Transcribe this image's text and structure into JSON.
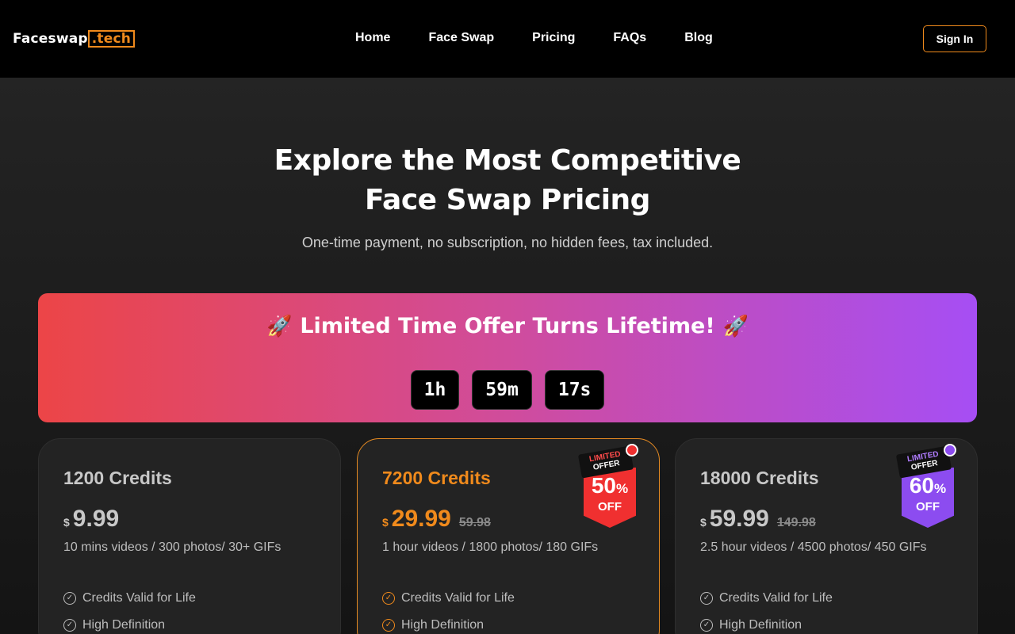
{
  "header": {
    "logo_main": "Faceswap",
    "logo_tld": ".tech",
    "nav": [
      "Home",
      "Face Swap",
      "Pricing",
      "FAQs",
      "Blog"
    ],
    "signin": "Sign In"
  },
  "hero": {
    "title": "Explore the Most Competitive Face Swap Pricing",
    "subtitle": "One-time payment, no subscription, no hidden fees, tax included."
  },
  "banner": {
    "title": "Limited Time Offer Turns Lifetime!",
    "icon": "rocket-icon",
    "timer": {
      "hours": "1h",
      "minutes": "59m",
      "seconds": "17s"
    }
  },
  "plans": [
    {
      "name": "1200 Credits",
      "currency": "$",
      "price": "9.99",
      "old_price": "",
      "desc": "10 mins videos / 300 photos/ 30+ GIFs",
      "features": [
        "Credits Valid for Life",
        "High Definition"
      ]
    },
    {
      "name": "7200 Credits",
      "currency": "$",
      "price": "29.99",
      "old_price": "59.98",
      "desc": "1 hour videos / 1800 photos/ 180 GIFs",
      "features": [
        "Credits Valid for Life",
        "High Definition"
      ],
      "badge": {
        "line1": "LIMITED",
        "line2": "OFFER",
        "pct": "50",
        "pct_sign": "%",
        "off": "OFF"
      }
    },
    {
      "name": "18000 Credits",
      "currency": "$",
      "price": "59.99",
      "old_price": "149.98",
      "desc": "2.5 hour videos / 4500 photos/ 450 GIFs",
      "features": [
        "Credits Valid for Life",
        "High Definition"
      ],
      "badge": {
        "line1": "LIMITED",
        "line2": "OFFER",
        "pct": "60",
        "pct_sign": "%",
        "off": "OFF"
      }
    }
  ],
  "colors": {
    "accent": "#f08a1c",
    "banner_start": "#ec4547",
    "banner_end": "#a64ef4"
  }
}
